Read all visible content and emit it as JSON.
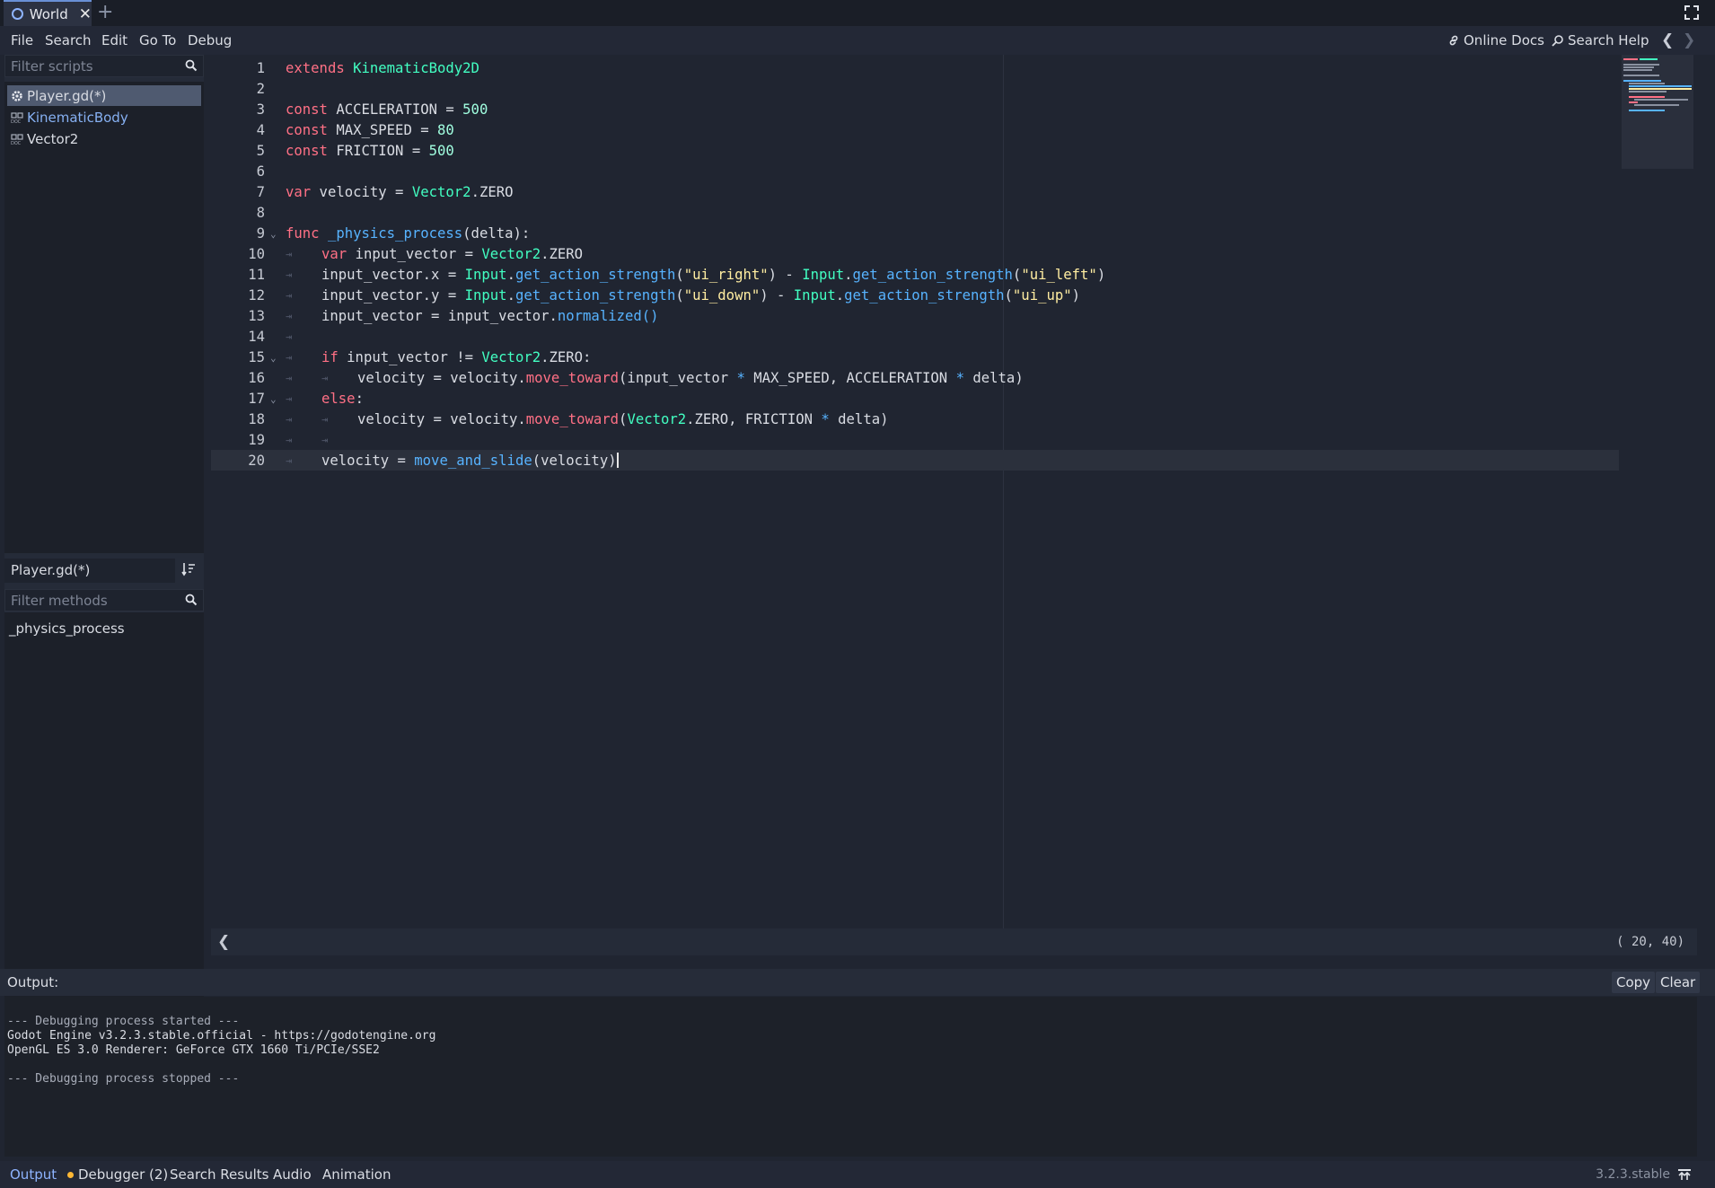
{
  "colors": {
    "background": "#202531",
    "keyword": "#ff7085",
    "type": "#42ffc2",
    "function": "#57b3ff",
    "number": "#a1ffe0",
    "string": "#ffeda1",
    "accent": "#8eb4ff"
  },
  "tabs": [
    {
      "label": "World"
    }
  ],
  "menu": {
    "file": "File",
    "search": "Search",
    "edit": "Edit",
    "goto": "Go To",
    "debug": "Debug"
  },
  "topright": {
    "online_docs": "Online Docs",
    "search_help": "Search Help"
  },
  "scripts": {
    "filter_placeholder": "Filter scripts",
    "items": [
      {
        "label": "Player.gd(*)",
        "icon": "gear-icon"
      },
      {
        "label": "KinematicBody",
        "icon": "doc-icon"
      },
      {
        "label": "Vector2",
        "icon": "doc-icon"
      }
    ]
  },
  "methods": {
    "script_name": "Player.gd(*)",
    "filter_placeholder": "Filter methods",
    "items": [
      "_physics_process"
    ]
  },
  "code": {
    "line_numbers": [
      "1",
      "2",
      "3",
      "4",
      "5",
      "6",
      "7",
      "8",
      "9",
      "10",
      "11",
      "12",
      "13",
      "14",
      "15",
      "16",
      "17",
      "18",
      "19",
      "20"
    ],
    "l1": {
      "a": "extends",
      "b": "KinematicBody2D"
    },
    "l3": {
      "a": "const",
      "b": " ACCELERATION = ",
      "c": "500"
    },
    "l4": {
      "a": "const",
      "b": " MAX_SPEED = ",
      "c": "80"
    },
    "l5": {
      "a": "const",
      "b": " FRICTION = ",
      "c": "500"
    },
    "l7": {
      "a": "var",
      "b": " velocity = ",
      "c": "Vector2",
      "d": ".ZERO"
    },
    "l9": {
      "a": "func",
      "b": "_physics_process",
      "c": "(delta):"
    },
    "l10": {
      "a": "var",
      "b": " input_vector = ",
      "c": "Vector2",
      "d": ".ZERO"
    },
    "l11": {
      "a": "input_vector.x = ",
      "b": "Input",
      "c": ".",
      "d": "get_action_strength",
      "e": "(",
      "f": "\"ui_right\"",
      "g": ") - ",
      "h": "Input",
      "i": ".",
      "j": "get_action_strength",
      "k": "(",
      "l": "\"ui_left\"",
      "m": ")"
    },
    "l12": {
      "a": "input_vector.y = ",
      "b": "Input",
      "c": ".",
      "d": "get_action_strength",
      "e": "(",
      "f": "\"ui_down\"",
      "g": ") - ",
      "h": "Input",
      "i": ".",
      "j": "get_action_strength",
      "k": "(",
      "l": "\"ui_up\"",
      "m": ")"
    },
    "l13": {
      "a": "input_vector = input_vector.",
      "b": "normalized",
      "c": "()"
    },
    "l15": {
      "a": "if",
      "b": " input_vector != ",
      "c": "Vector2",
      "d": ".ZERO:"
    },
    "l16": {
      "a": "velocity = velocity.",
      "b": "move_toward",
      "c": "(input_vector ",
      "d": "*",
      "e": " MAX_SPEED, ACCELERATION ",
      "f": "*",
      "g": " delta)"
    },
    "l17": {
      "a": "else",
      "b": ":"
    },
    "l18": {
      "a": "velocity = velocity.",
      "b": "move_toward",
      "c": "(",
      "d": "Vector2",
      "e": ".ZERO, FRICTION ",
      "f": "*",
      "g": " delta)"
    },
    "l20": {
      "a": "velocity = ",
      "b": "move_and_slide",
      "c": "(velocity)"
    }
  },
  "editor_status": {
    "cursor_pos": "( 20, 40)"
  },
  "output": {
    "title": "Output:",
    "copy": "Copy",
    "clear": "Clear",
    "lines": [
      "--- Debugging process started ---",
      "Godot Engine v3.2.3.stable.official - https://godotengine.org",
      "OpenGL ES 3.0 Renderer: GeForce GTX 1660 Ti/PCIe/SSE2",
      "",
      "--- Debugging process stopped ---"
    ]
  },
  "bottom_tabs": [
    "Output",
    "Debugger (2)",
    "Search Results",
    "Audio",
    "Animation"
  ],
  "version": "3.2.3.stable"
}
